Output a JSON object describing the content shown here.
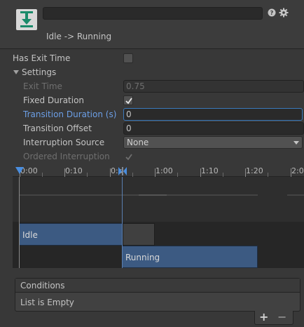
{
  "header": {
    "name_value": "",
    "transition_title": "Idle -> Running"
  },
  "props": {
    "has_exit_time": {
      "label": "Has Exit Time",
      "checked": false
    },
    "settings": {
      "label": "Settings",
      "expanded": true
    },
    "exit_time": {
      "label": "Exit Time",
      "value": "0.75",
      "enabled": false
    },
    "fixed_duration": {
      "label": "Fixed Duration",
      "checked": true
    },
    "transition_duration": {
      "label": "Transition Duration (s)",
      "value": "0"
    },
    "transition_offset": {
      "label": "Transition Offset",
      "value": "0"
    },
    "interruption_source": {
      "label": "Interruption Source",
      "selected": "None"
    },
    "ordered_interruption": {
      "label": "Ordered Interruption",
      "checked": true,
      "enabled": false
    }
  },
  "timeline": {
    "ticks": [
      "0:00",
      "0:10",
      "0:s",
      "1:00",
      "1:10",
      "1:20",
      "2:0"
    ],
    "idle_label": "Idle",
    "running_label": "Running"
  },
  "conditions": {
    "title": "Conditions",
    "empty_text": "List is Empty",
    "add_label": "+",
    "remove_label": "−"
  },
  "colors": {
    "accent": "#3a79bb",
    "state_bar": "#3c5a82"
  }
}
